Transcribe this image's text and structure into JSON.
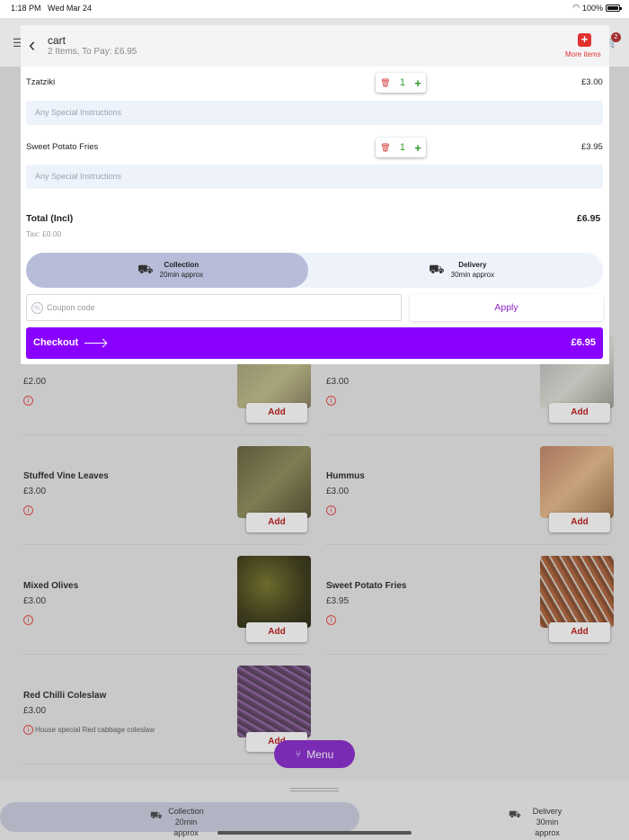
{
  "status": {
    "time": "1:18 PM",
    "date": "Wed Mar 24",
    "battery": "100%"
  },
  "cart": {
    "title": "cart",
    "subtitle": "2 Items, To Pay: £6.95",
    "more_items_label": "More items",
    "lines": [
      {
        "name": "Tzatziki",
        "qty": "1",
        "price": "£3.00",
        "instructions_placeholder": "Any Special Instructions"
      },
      {
        "name": "Sweet Potato Fries",
        "qty": "1",
        "price": "£3.95",
        "instructions_placeholder": "Any Special Instructions"
      }
    ],
    "total_label": "Total (Incl)",
    "total_value": "£6.95",
    "tax": "Tax: £0.00",
    "fulfilment": {
      "selected": "collection",
      "collection": {
        "title": "Collection",
        "eta": "20min approx"
      },
      "delivery": {
        "title": "Delivery",
        "eta": "30min approx"
      }
    },
    "coupon_placeholder": "Coupon code",
    "apply_label": "Apply",
    "checkout_label": "Checkout",
    "checkout_amount": "£6.95"
  },
  "menu_items": [
    {
      "name": "",
      "price": "£2.00",
      "add": "Add",
      "description": ""
    },
    {
      "name": "",
      "price": "£3.00",
      "add": "Add",
      "description": ""
    },
    {
      "name": "Stuffed Vine Leaves",
      "price": "£3.00",
      "add": "Add",
      "description": ""
    },
    {
      "name": "Hummus",
      "price": "£3.00",
      "add": "Add",
      "description": ""
    },
    {
      "name": "Mixed Olives",
      "price": "£3.00",
      "add": "Add",
      "description": ""
    },
    {
      "name": "Sweet Potato Fries",
      "price": "£3.95",
      "add": "Add",
      "description": ""
    },
    {
      "name": "Red Chilli Coleslaw",
      "price": "£3.00",
      "add": "Add",
      "description": "House special Red cabbage coleslaw"
    }
  ],
  "menu_button": "Menu",
  "bottom_bar": {
    "collection": {
      "title": "Collection",
      "eta": "20min approx"
    },
    "delivery": {
      "title": "Delivery",
      "eta": "30min approx"
    }
  },
  "cart_badge": "2",
  "colors": {
    "accent": "#8a00ff",
    "danger": "#e23030",
    "add_text": "#a51d1d",
    "quantity": "#2e9a2e"
  }
}
